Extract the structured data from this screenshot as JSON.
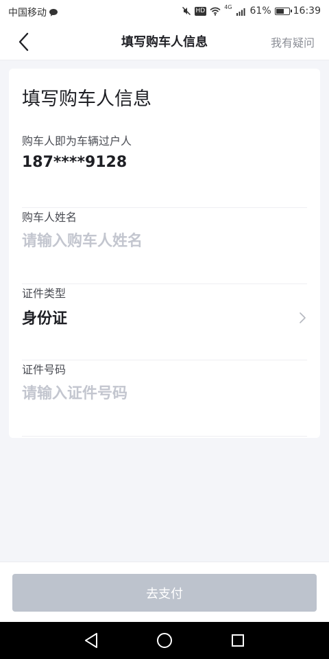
{
  "status_bar": {
    "carrier": "中国移动",
    "hd": "HD",
    "network": "4G",
    "battery_percent": "61%",
    "battery_level": 0.61,
    "time": "16:39"
  },
  "nav": {
    "title": "填写购车人信息",
    "help": "我有疑问"
  },
  "form": {
    "title": "填写购车人信息",
    "phone_label": "购车人即为车辆过户人",
    "phone_value": "187****9128",
    "name_label": "购车人姓名",
    "name_placeholder": "请输入购车人姓名",
    "id_type_label": "证件类型",
    "id_type_value": "身份证",
    "id_number_label": "证件号码",
    "id_number_placeholder": "请输入证件号码"
  },
  "actions": {
    "pay_label": "去支付"
  },
  "colors": {
    "page_bg": "#f4f5f9",
    "button_disabled": "#bdc3cd",
    "placeholder": "#c3c6cf",
    "text_primary": "#1e1f24"
  },
  "icons": {
    "back": "back-arrow-icon",
    "chevron": "chevron-right-icon",
    "sys_back": "triangle-back-icon",
    "sys_home": "circle-home-icon",
    "sys_recent": "square-recent-icon"
  }
}
